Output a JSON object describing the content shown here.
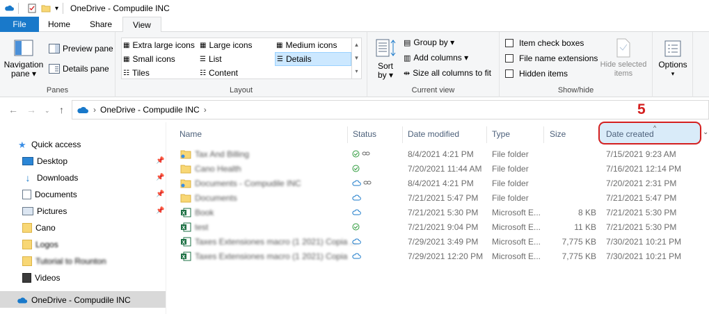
{
  "window": {
    "title": "OneDrive - Compudile INC"
  },
  "tabs": [
    "File",
    "Home",
    "Share",
    "View"
  ],
  "ribbon": {
    "panes": {
      "navigation_pane": "Navigation\npane ▾",
      "preview_pane": "Preview pane",
      "details_pane": "Details pane",
      "group_label": "Panes"
    },
    "layout": {
      "items": [
        "Extra large icons",
        "Large icons",
        "Medium icons",
        "Small icons",
        "List",
        "Details",
        "Tiles",
        "Content"
      ],
      "selected": "Details",
      "group_label": "Layout"
    },
    "current_view": {
      "sort_by": "Sort\nby ▾",
      "group_by": "Group by ▾",
      "add_columns": "Add columns ▾",
      "size_all": "Size all columns to fit",
      "group_label": "Current view"
    },
    "show_hide": {
      "item_check_boxes": "Item check boxes",
      "file_name_extensions": "File name extensions",
      "hidden_items": "Hidden items",
      "hide_selected": "Hide selected\nitems",
      "group_label": "Show/hide"
    },
    "options": {
      "label": "Options"
    }
  },
  "address": {
    "crumb": "OneDrive - Compudile INC"
  },
  "sidebar": {
    "quick_access": "Quick access",
    "items": [
      {
        "label": "Desktop",
        "pinned": true
      },
      {
        "label": "Downloads",
        "pinned": true
      },
      {
        "label": "Documents",
        "pinned": true
      },
      {
        "label": "Pictures",
        "pinned": true
      },
      {
        "label": "Cano",
        "pinned": false
      },
      {
        "label": "Logos",
        "pinned": false
      },
      {
        "label": "Tutorial to Rounton",
        "pinned": false
      },
      {
        "label": "Videos",
        "pinned": false
      }
    ],
    "onedrive": "OneDrive - Compudile INC"
  },
  "annotation": {
    "step": "5"
  },
  "columns": [
    "Name",
    "Status",
    "Date modified",
    "Type",
    "Size",
    "Date created"
  ],
  "files": [
    {
      "name": "Tax And Billing",
      "status": "synced-shared",
      "modified": "8/4/2021 4:21 PM",
      "type": "File folder",
      "size": "",
      "created": "7/15/2021 9:23 AM",
      "icon": "folder-shared"
    },
    {
      "name": "Cano Health",
      "status": "synced",
      "modified": "7/20/2021 11:44 AM",
      "type": "File folder",
      "size": "",
      "created": "7/16/2021 12:14 PM",
      "icon": "folder"
    },
    {
      "name": "Documents - Compudile INC",
      "status": "cloud-shared",
      "modified": "8/4/2021 4:21 PM",
      "type": "File folder",
      "size": "",
      "created": "7/20/2021 2:31 PM",
      "icon": "folder-shared"
    },
    {
      "name": "Documents",
      "status": "cloud",
      "modified": "7/21/2021 5:47 PM",
      "type": "File folder",
      "size": "",
      "created": "7/21/2021 5:47 PM",
      "icon": "folder"
    },
    {
      "name": "Book",
      "status": "cloud",
      "modified": "7/21/2021 5:30 PM",
      "type": "Microsoft E...",
      "size": "8 KB",
      "created": "7/21/2021 5:30 PM",
      "icon": "excel"
    },
    {
      "name": "test",
      "status": "synced",
      "modified": "7/21/2021 9:04 PM",
      "type": "Microsoft E...",
      "size": "11 KB",
      "created": "7/21/2021 5:30 PM",
      "icon": "excel"
    },
    {
      "name": "Taxes Extensiones macro (1 2021) Copia ...",
      "status": "cloud",
      "modified": "7/29/2021 3:49 PM",
      "type": "Microsoft E...",
      "size": "7,775 KB",
      "created": "7/30/2021 10:21 PM",
      "icon": "excel"
    },
    {
      "name": "Taxes Extensiones macro (1 2021) Copia",
      "status": "cloud",
      "modified": "7/29/2021 12:20 PM",
      "type": "Microsoft E...",
      "size": "7,775 KB",
      "created": "7/30/2021 10:21 PM",
      "icon": "excel"
    }
  ],
  "colors": {
    "accent": "#1979ca",
    "highlight": "#d41f1f",
    "selected_header": "#d9ebf9"
  }
}
